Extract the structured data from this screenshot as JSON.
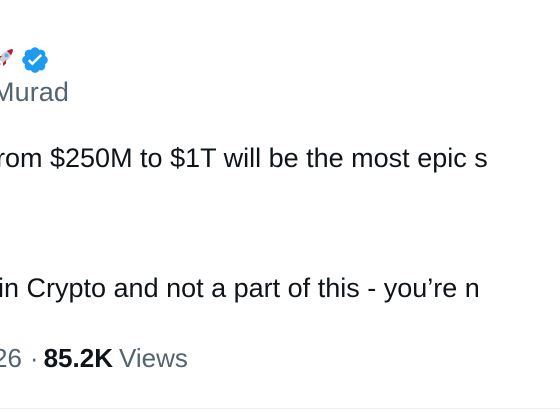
{
  "author": {
    "handle": "Murad",
    "verified": true,
    "name_emoji": "rocket-icon",
    "badge_color": "#1d9bf0"
  },
  "tweet": {
    "line1": "rom $250M to $1T will be the most epic s",
    "line2": "in Crypto and not a part of this - you’re n"
  },
  "meta": {
    "time_fragment": "26",
    "separator": "·",
    "views_count": "85.2K",
    "views_label": "Views"
  },
  "colors": {
    "text_primary": "#0f1419",
    "text_secondary": "#536471",
    "accent": "#1d9bf0"
  }
}
